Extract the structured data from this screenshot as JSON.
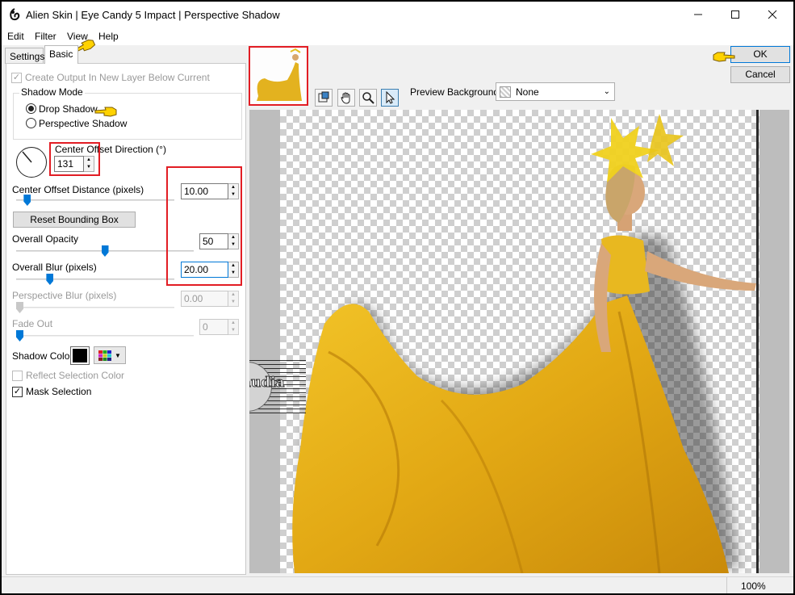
{
  "window": {
    "title": "Alien Skin | Eye Candy 5 Impact | Perspective Shadow"
  },
  "menu": {
    "items": [
      "Edit",
      "Filter",
      "View",
      "Help"
    ]
  },
  "tabs": [
    {
      "label": "Settings",
      "active": false
    },
    {
      "label": "Basic",
      "active": true
    }
  ],
  "basic": {
    "create_output_label": "Create Output In New Layer Below Current",
    "create_output_checked": true,
    "shadow_mode_label": "Shadow Mode",
    "drop_shadow_label": "Drop Shadow",
    "perspective_shadow_label": "Perspective Shadow",
    "shadow_mode_selected": "Drop Shadow",
    "center_offset_direction_label": "Center Offset Direction (°)",
    "center_offset_direction_value": "131",
    "center_offset_distance_label": "Center Offset Distance (pixels)",
    "center_offset_distance_value": "10.00",
    "reset_bounding_box_label": "Reset Bounding Box",
    "overall_opacity_label": "Overall Opacity",
    "overall_opacity_value": "50",
    "overall_blur_label": "Overall Blur (pixels)",
    "overall_blur_value": "20.00",
    "perspective_blur_label": "Perspective Blur (pixels)",
    "perspective_blur_value": "0.00",
    "fade_out_label": "Fade Out",
    "fade_out_value": "0",
    "shadow_color_label": "Shadow Color",
    "shadow_color": "#000000",
    "reflect_selection_color_label": "Reflect Selection Color",
    "reflect_selection_color_checked": false,
    "mask_selection_label": "Mask Selection",
    "mask_selection_checked": true
  },
  "sliders": {
    "center_offset_distance_fraction": 0.05,
    "overall_opacity_fraction": 0.5,
    "overall_blur_fraction": 0.2,
    "perspective_blur_fraction": 0.0,
    "fade_out_fraction": 0.0
  },
  "buttons": {
    "ok_label": "OK",
    "cancel_label": "Cancel"
  },
  "preview": {
    "background_label": "Preview Background:",
    "background_value": "None"
  },
  "status": {
    "zoom": "100%"
  },
  "watermark": {
    "text": "claudia"
  },
  "colors": {
    "accent": "#0078d7",
    "annotation_red": "#e21d24",
    "dress_yellow": "#e8b820",
    "pointer_yellow": "#ffd200"
  },
  "icons": [
    "eye-candy-app-icon",
    "minimize-icon",
    "maximize-icon",
    "close-icon",
    "pointing-hand-icon",
    "preview-toggle-icon",
    "hand-pan-icon",
    "zoom-icon",
    "arrow-select-icon",
    "color-palette-icon",
    "chevron-down-icon"
  ]
}
